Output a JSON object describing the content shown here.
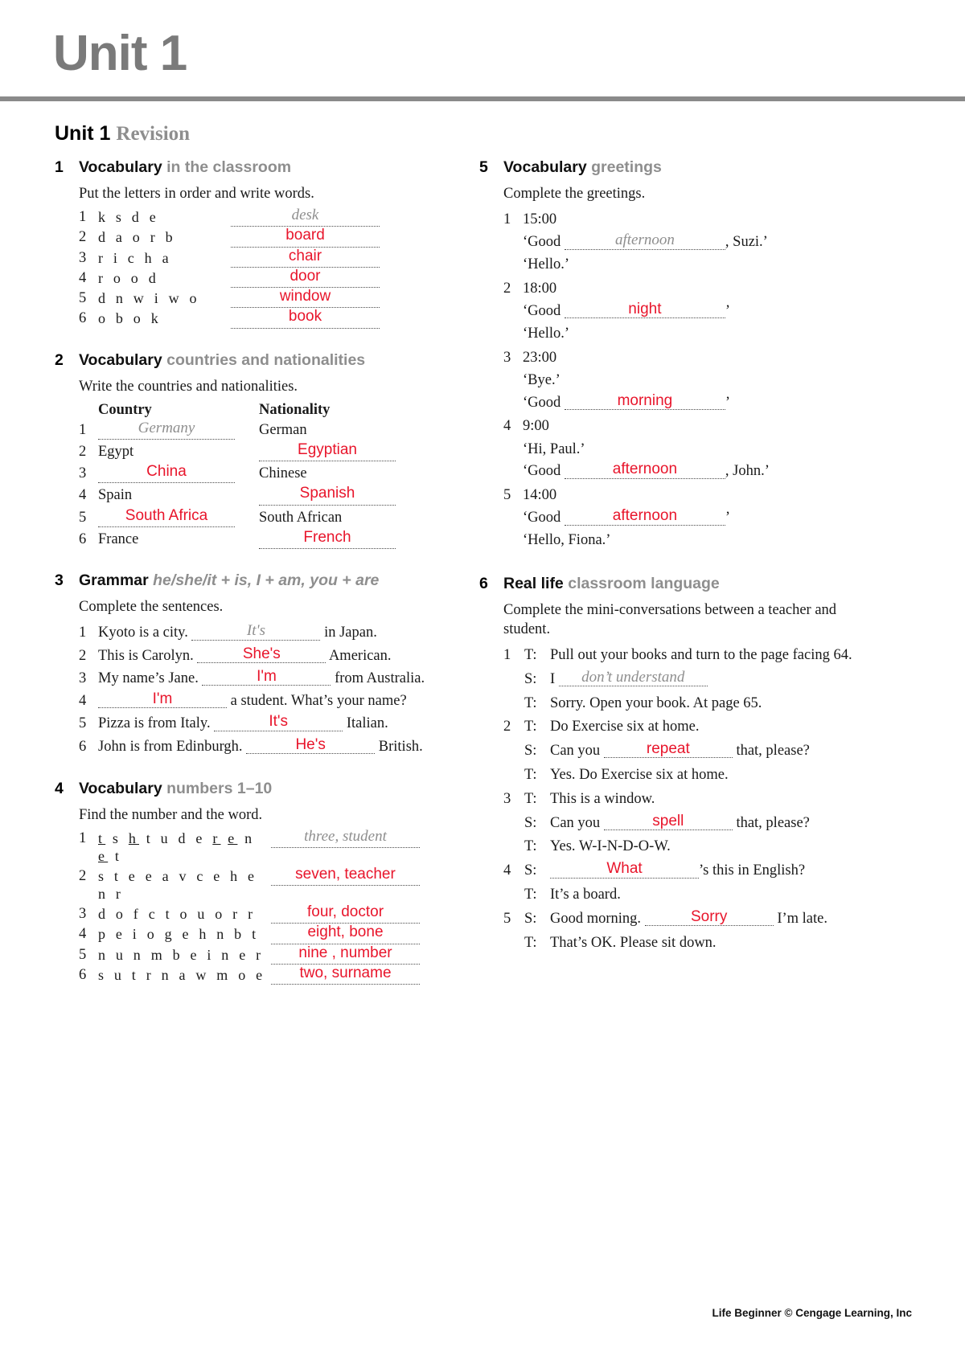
{
  "header": {
    "unit_title": "Unit 1"
  },
  "revision": {
    "bold": "Unit 1",
    "grey": "Revision"
  },
  "footer": {
    "text": "Life Beginner   © Cengage Learning, Inc"
  },
  "colors": {
    "answer_red": "#e8152b",
    "example_grey": "#8e8e8e",
    "accent_grey": "#7a7a7a"
  },
  "ex1": {
    "num": "1",
    "title_bold": "Vocabulary",
    "title_grey": "in the classroom",
    "instruction": "Put the letters in order and write words.",
    "items": [
      {
        "n": "1",
        "cue": "k s d e",
        "answer": "desk",
        "style": "example"
      },
      {
        "n": "2",
        "cue": "d a o r b",
        "answer": "board",
        "style": "filled"
      },
      {
        "n": "3",
        "cue": "r i c h a",
        "answer": "chair",
        "style": "filled"
      },
      {
        "n": "4",
        "cue": "r o o d",
        "answer": "door",
        "style": "filled"
      },
      {
        "n": "5",
        "cue": "d n w i w o",
        "answer": "window",
        "style": "filled"
      },
      {
        "n": "6",
        "cue": "o b o k",
        "answer": "book",
        "style": "filled"
      }
    ]
  },
  "ex2": {
    "num": "2",
    "title_bold": "Vocabulary",
    "title_grey": "countries and nationalities",
    "instruction": "Write the countries and nationalities.",
    "head_country": "Country",
    "head_nationality": "Nationality",
    "rows": [
      {
        "n": "1",
        "country": "Germany",
        "country_state": "example",
        "nationality": "German",
        "nationality_state": "given"
      },
      {
        "n": "2",
        "country": "Egypt",
        "country_state": "given",
        "nationality": "Egyptian",
        "nationality_state": "filled"
      },
      {
        "n": "3",
        "country": "China",
        "country_state": "filled",
        "nationality": "Chinese",
        "nationality_state": "given"
      },
      {
        "n": "4",
        "country": "Spain",
        "country_state": "given",
        "nationality": "Spanish",
        "nationality_state": "filled"
      },
      {
        "n": "5",
        "country": "South Africa",
        "country_state": "filled",
        "nationality": "South African",
        "nationality_state": "given"
      },
      {
        "n": "6",
        "country": "France",
        "country_state": "given",
        "nationality": "French",
        "nationality_state": "filled"
      }
    ]
  },
  "ex3": {
    "num": "3",
    "title_bold": "Grammar",
    "title_italic": "he/she/it + is, I + am, you + are",
    "instruction": "Complete the sentences.",
    "items": [
      {
        "n": "1",
        "before": "Kyoto is a city.",
        "answer": "It's",
        "style": "example",
        "after": "in Japan."
      },
      {
        "n": "2",
        "before": "This is Carolyn.",
        "answer": "She's",
        "style": "filled",
        "after": "American."
      },
      {
        "n": "3",
        "before": "My name’s Jane.",
        "answer": "I'm",
        "style": "filled",
        "after": "from Australia."
      },
      {
        "n": "4",
        "before": "",
        "answer": "I'm",
        "style": "filled",
        "after": "a student. What’s your name?"
      },
      {
        "n": "5",
        "before": "Pizza is from Italy.",
        "answer": "It's",
        "style": "filled",
        "after": "Italian."
      },
      {
        "n": "6",
        "before": "John is from Edinburgh.",
        "answer": "He's",
        "style": "filled",
        "after": "British."
      }
    ]
  },
  "ex4": {
    "num": "4",
    "title_bold": "Vocabulary",
    "title_grey": "numbers 1–10",
    "instruction": "Find the number and the word.",
    "items": [
      {
        "n": "1",
        "cue": "t s h t u d e r e n e t",
        "answer": "three, student",
        "style": "example"
      },
      {
        "n": "2",
        "cue": "s t e e a v c e h e n r",
        "answer": "seven, teacher",
        "style": "filled"
      },
      {
        "n": "3",
        "cue": "d o f c t o u o r r",
        "answer": "four, doctor",
        "style": "filled"
      },
      {
        "n": "4",
        "cue": "p e i o g e h n b t",
        "answer": "eight, bone",
        "style": "filled"
      },
      {
        "n": "5",
        "cue": "n u n m b e i n e r",
        "answer": "nine , number",
        "style": "filled"
      },
      {
        "n": "6",
        "cue": "s u t r n a w m o e",
        "answer": "two, surname",
        "style": "filled"
      }
    ]
  },
  "ex5": {
    "num": "5",
    "title_bold": "Vocabulary",
    "title_grey": "greetings",
    "instruction": "Complete the greetings.",
    "items": [
      {
        "n": "1",
        "time": "15:00",
        "lines": [
          {
            "pre": "‘Good ",
            "answer": "afternoon",
            "style": "example",
            "post": ", Suzi.’"
          },
          {
            "pre": "‘Hello.’",
            "answer": "",
            "style": "none",
            "post": ""
          }
        ]
      },
      {
        "n": "2",
        "time": "18:00",
        "lines": [
          {
            "pre": "‘Good ",
            "answer": "night",
            "style": "filled",
            "post": "’"
          },
          {
            "pre": "‘Hello.’",
            "answer": "",
            "style": "none",
            "post": ""
          }
        ]
      },
      {
        "n": "3",
        "time": "23:00",
        "lines": [
          {
            "pre": "‘Bye.’",
            "answer": "",
            "style": "none",
            "post": ""
          },
          {
            "pre": "‘Good ",
            "answer": "morning",
            "style": "filled",
            "post": "’"
          }
        ]
      },
      {
        "n": "4",
        "time": "9:00",
        "lines": [
          {
            "pre": "‘Hi, Paul.’",
            "answer": "",
            "style": "none",
            "post": ""
          },
          {
            "pre": "‘Good ",
            "answer": "afternoon",
            "style": "filled",
            "post": ", John.’"
          }
        ]
      },
      {
        "n": "5",
        "time": "14:00",
        "lines": [
          {
            "pre": "‘Good ",
            "answer": "afternoon",
            "style": "filled",
            "post": "’"
          },
          {
            "pre": "‘Hello, Fiona.’",
            "answer": "",
            "style": "none",
            "post": ""
          }
        ]
      }
    ]
  },
  "ex6": {
    "num": "6",
    "title_bold": "Real life",
    "title_grey": "classroom language",
    "instruction": "Complete the mini-conversations between a teacher and student.",
    "conversations": [
      {
        "n": "1",
        "turns": [
          {
            "speaker": "T:",
            "pre": "Pull out your books and turn to the page facing 64.",
            "answer": "",
            "style": "none",
            "post": ""
          },
          {
            "speaker": "S:",
            "pre": "I ",
            "answer": "don’t understand",
            "style": "example",
            "post": ""
          },
          {
            "speaker": "T:",
            "pre": "Sorry. Open your book. At page 65.",
            "answer": "",
            "style": "none",
            "post": ""
          }
        ]
      },
      {
        "n": "2",
        "turns": [
          {
            "speaker": "T:",
            "pre": "Do Exercise six at home.",
            "answer": "",
            "style": "none",
            "post": ""
          },
          {
            "speaker": "S:",
            "pre": "Can you ",
            "answer": "repeat",
            "style": "filled",
            "post": " that, please?"
          },
          {
            "speaker": "T:",
            "pre": "Yes. Do Exercise six at home.",
            "answer": "",
            "style": "none",
            "post": ""
          }
        ]
      },
      {
        "n": "3",
        "turns": [
          {
            "speaker": "T:",
            "pre": "This is a window.",
            "answer": "",
            "style": "none",
            "post": ""
          },
          {
            "speaker": "S:",
            "pre": "Can you ",
            "answer": "spell",
            "style": "filled",
            "post": " that, please?"
          },
          {
            "speaker": "T:",
            "pre": "Yes. W-I-N-D-O-W.",
            "answer": "",
            "style": "none",
            "post": ""
          }
        ]
      },
      {
        "n": "4",
        "turns": [
          {
            "speaker": "S:",
            "pre": "",
            "answer": "What",
            "style": "filled",
            "post": "’s this in English?"
          },
          {
            "speaker": "T:",
            "pre": "It’s a board.",
            "answer": "",
            "style": "none",
            "post": ""
          }
        ]
      },
      {
        "n": "5",
        "turns": [
          {
            "speaker": "S:",
            "pre": "Good morning. ",
            "answer": "Sorry",
            "style": "filled",
            "post": " I’m late."
          },
          {
            "speaker": "T:",
            "pre": "That’s OK. Please sit down.",
            "answer": "",
            "style": "none",
            "post": ""
          }
        ]
      }
    ]
  }
}
